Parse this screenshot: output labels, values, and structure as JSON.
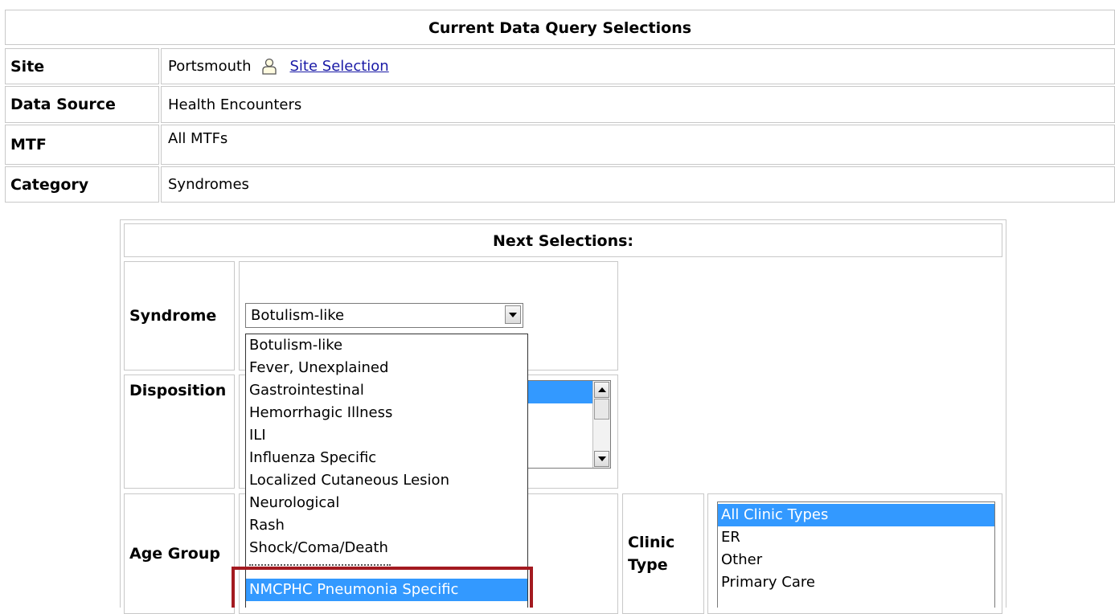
{
  "current": {
    "title": "Current Data Query Selections",
    "rows": [
      {
        "label": "Site",
        "value": "Portsmouth",
        "link": "Site Selection"
      },
      {
        "label": "Data Source",
        "value": "Health Encounters"
      },
      {
        "label": "MTF",
        "value": "All MTFs"
      },
      {
        "label": "Category",
        "value": "Syndromes"
      }
    ]
  },
  "next": {
    "title": "Next Selections:",
    "syndrome": {
      "label": "Syndrome",
      "selected": "Botulism-like",
      "options": [
        "Botulism-like",
        "Fever, Unexplained",
        "Gastrointestinal",
        "Hemorrhagic Illness",
        "ILI",
        "Influenza Specific",
        "Localized Cutaneous Lesion",
        "Neurological",
        "Rash",
        "Shock/Coma/Death",
        "NMCPHC Pneumonia Specific"
      ],
      "highlighted": "NMCPHC Pneumonia Specific"
    },
    "disposition": {
      "label": "Disposition"
    },
    "age_group": {
      "label": "Age Group"
    },
    "clinic_type": {
      "label_line1": "Clinic",
      "label_line2": "Type",
      "options": [
        "All Clinic Types",
        "ER",
        "Other",
        "Primary Care"
      ],
      "selected": "All Clinic Types"
    }
  },
  "colors": {
    "selection": "#3399ff",
    "link": "#1a1aa6",
    "highlight_box": "#a31a20"
  }
}
